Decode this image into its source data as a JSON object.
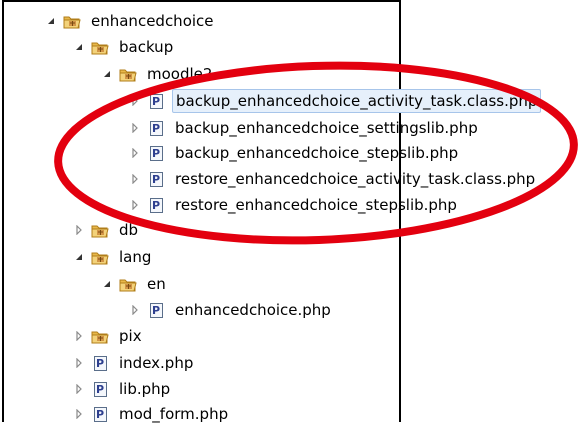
{
  "tree": {
    "items": [
      {
        "label": "enhancedchoice",
        "kind": "package",
        "expanded": true,
        "has_children": true
      },
      {
        "label": "backup",
        "kind": "package",
        "expanded": true,
        "has_children": true
      },
      {
        "label": "moodle2",
        "kind": "package",
        "expanded": true,
        "has_children": true
      },
      {
        "label": "backup_enhancedchoice_activity_task.class.php",
        "kind": "php",
        "expanded": false,
        "has_children": true,
        "selected": true
      },
      {
        "label": "backup_enhancedchoice_settingslib.php",
        "kind": "php",
        "expanded": false,
        "has_children": true
      },
      {
        "label": "backup_enhancedchoice_stepslib.php",
        "kind": "php",
        "expanded": false,
        "has_children": true
      },
      {
        "label": "restore_enhancedchoice_activity_task.class.php",
        "kind": "php",
        "expanded": false,
        "has_children": true
      },
      {
        "label": "restore_enhancedchoice_stepslib.php",
        "kind": "php",
        "expanded": false,
        "has_children": true
      },
      {
        "label": "db",
        "kind": "package",
        "expanded": false,
        "has_children": true
      },
      {
        "label": "lang",
        "kind": "package",
        "expanded": true,
        "has_children": true
      },
      {
        "label": "en",
        "kind": "package",
        "expanded": true,
        "has_children": true
      },
      {
        "label": "enhancedchoice.php",
        "kind": "php",
        "expanded": false,
        "has_children": true
      },
      {
        "label": "pix",
        "kind": "package",
        "expanded": false,
        "has_children": true
      },
      {
        "label": "index.php",
        "kind": "php",
        "expanded": false,
        "has_children": true
      },
      {
        "label": "lib.php",
        "kind": "php",
        "expanded": false,
        "has_children": true
      },
      {
        "label": "mod_form.php",
        "kind": "php",
        "expanded": false,
        "has_children": true
      }
    ]
  },
  "icons": {
    "package": "package-folder-icon",
    "php": "php-file-icon"
  },
  "colors": {
    "highlight_ellipse": "#e3000f",
    "selection_bg": "#e6f0fb",
    "folder_yellow": "#e8b84a"
  },
  "php_icon_letter": "P"
}
